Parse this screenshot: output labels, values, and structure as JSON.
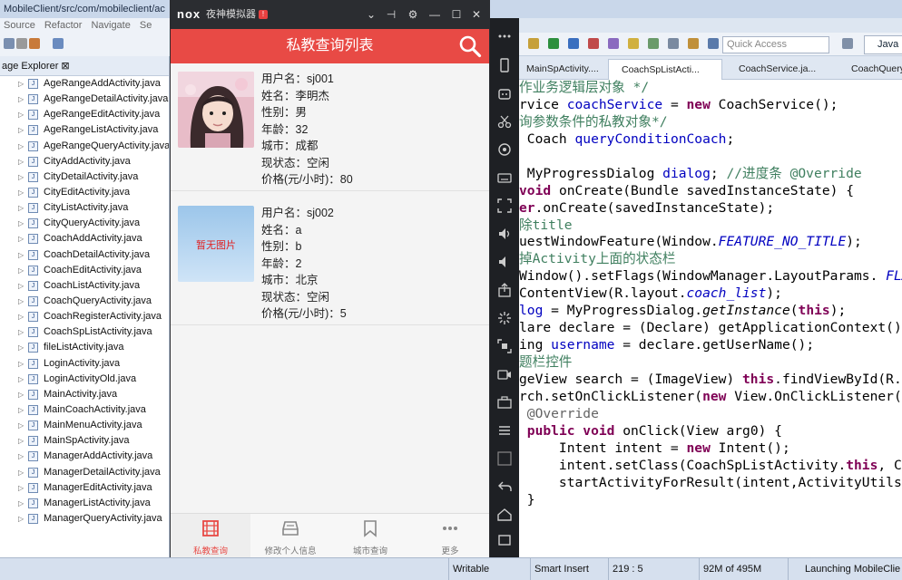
{
  "ide": {
    "title": "MobileClient/src/com/mobileclient/ac",
    "menu": [
      "Source",
      "Refactor",
      "Navigate",
      "Se"
    ],
    "quick_access_placeholder": "Quick Access",
    "perspective": "Java",
    "explorer_title": "age Explorer ⊠",
    "files": [
      "AgeRangeAddActivity.java",
      "AgeRangeDetailActivity.java",
      "AgeRangeEditActivity.java",
      "AgeRangeListActivity.java",
      "AgeRangeQueryActivity.java",
      "CityAddActivity.java",
      "CityDetailActivity.java",
      "CityEditActivity.java",
      "CityListActivity.java",
      "CityQueryActivity.java",
      "CoachAddActivity.java",
      "CoachDetailActivity.java",
      "CoachEditActivity.java",
      "CoachListActivity.java",
      "CoachQueryActivity.java",
      "CoachRegisterActivity.java",
      "CoachSpListActivity.java",
      "fileListActivity.java",
      "LoginActivity.java",
      "LoginActivityOld.java",
      "MainActivity.java",
      "MainCoachActivity.java",
      "MainMenuActivity.java",
      "MainSpActivity.java",
      "ManagerAddActivity.java",
      "ManagerDetailActivity.java",
      "ManagerEditActivity.java",
      "ManagerListActivity.java",
      "ManagerQueryActivity.java"
    ],
    "editor_tabs": [
      "MainSpActivity....",
      "CoachSpListActi...",
      "CoachService.ja...",
      "CoachQuery"
    ],
    "status": {
      "mode": "Writable",
      "insert": "Smart Insert",
      "position": "219 : 5",
      "memory": "92M of 495M",
      "task": "Launching MobileClie"
    }
  },
  "emulator": {
    "logo": "nox",
    "name": "夜神模拟器",
    "badge": "!",
    "controls": [
      "⌄",
      "⊣",
      "⚙",
      "—",
      "☐",
      "✕"
    ]
  },
  "app": {
    "title": "私教查询列表",
    "no_photo": "暂无图片",
    "coaches": [
      {
        "lines": [
          "用户名：sj001",
          "姓名：李明杰",
          "性别：男",
          "年龄：32",
          "城市：成都",
          "现状态：空闲",
          "价格(元/小时)：80"
        ]
      },
      {
        "lines": [
          "用户名：sj002",
          "姓名：a",
          "性别：b",
          "年龄：2",
          "城市：北京",
          "现状态：空闲",
          "价格(元/小时)：5"
        ]
      }
    ],
    "tabs": [
      "私教查询",
      "修改个人信息",
      "城市查询",
      "更多"
    ]
  },
  "code_lines": [
    [
      {
        "t": "作业务逻辑层对象 */",
        "c": "cm"
      }
    ],
    [
      {
        "t": "rvice "
      },
      {
        "t": "coachService",
        "c": "fi"
      },
      {
        "t": " = "
      },
      {
        "t": "new",
        "c": "kw"
      },
      {
        "t": " CoachService();"
      }
    ],
    [
      {
        "t": "询参数条件的私教对象*/",
        "c": "cm"
      }
    ],
    [
      {
        "t": " Coach "
      },
      {
        "t": "queryConditionCoach",
        "c": "fi"
      },
      {
        "t": ";"
      }
    ],
    [
      {
        "t": ""
      }
    ],
    [
      {
        "t": " MyProgressDialog "
      },
      {
        "t": "dialog",
        "c": "fi"
      },
      {
        "t": "; "
      },
      {
        "t": "//进度条 @Override",
        "c": "cm"
      }
    ],
    [
      {
        "t": "void",
        "c": "kw"
      },
      {
        "t": " onCreate(Bundle savedInstanceState) {"
      }
    ],
    [
      {
        "t": "er",
        "c": "kw"
      },
      {
        "t": ".onCreate(savedInstanceState);"
      }
    ],
    [
      {
        "t": "除title",
        "c": "cm"
      }
    ],
    [
      {
        "t": "uestWindowFeature(Window."
      },
      {
        "t": "FEATURE_NO_TITLE",
        "c": "fi it"
      },
      {
        "t": ");"
      }
    ],
    [
      {
        "t": "掉Activity上面的状态栏",
        "c": "cm"
      }
    ],
    [
      {
        "t": "Window().setFlags(WindowManager.LayoutParams. "
      },
      {
        "t": "FLAG",
        "c": "fi it"
      }
    ],
    [
      {
        "t": "ContentView(R.layout."
      },
      {
        "t": "coach_list",
        "c": "fi it"
      },
      {
        "t": ");"
      }
    ],
    [
      {
        "t": "log",
        "c": "fi"
      },
      {
        "t": " = MyProgressDialog."
      },
      {
        "t": "getInstance",
        "c": "it"
      },
      {
        "t": "("
      },
      {
        "t": "this",
        "c": "kw"
      },
      {
        "t": ");"
      }
    ],
    [
      {
        "t": "lare declare = (Declare) getApplicationContext();"
      }
    ],
    [
      {
        "t": "ing "
      },
      {
        "t": "username",
        "c": "fi"
      },
      {
        "t": " = declare.getUserName();"
      }
    ],
    [
      {
        "t": "题栏控件",
        "c": "cm"
      }
    ],
    [
      {
        "t": "geView search = (ImageView) "
      },
      {
        "t": "this",
        "c": "kw"
      },
      {
        "t": ".findViewById(R.id"
      }
    ],
    [
      {
        "t": "rch.setOnClickListener("
      },
      {
        "t": "new",
        "c": "kw"
      },
      {
        "t": " View.OnClickListener()"
      }
    ],
    [
      {
        "t": " @Override",
        "c": "an"
      }
    ],
    [
      {
        "t": " "
      },
      {
        "t": "public void",
        "c": "kw"
      },
      {
        "t": " onClick(View arg0) {"
      }
    ],
    [
      {
        "t": "     Intent intent = "
      },
      {
        "t": "new",
        "c": "kw"
      },
      {
        "t": " Intent();"
      }
    ],
    [
      {
        "t": "     intent.setClass(CoachSpListActivity."
      },
      {
        "t": "this",
        "c": "kw"
      },
      {
        "t": ", Coa"
      }
    ],
    [
      {
        "t": "     startActivityForResult(intent,ActivityUtils."
      }
    ],
    [
      {
        "t": " }"
      }
    ]
  ]
}
